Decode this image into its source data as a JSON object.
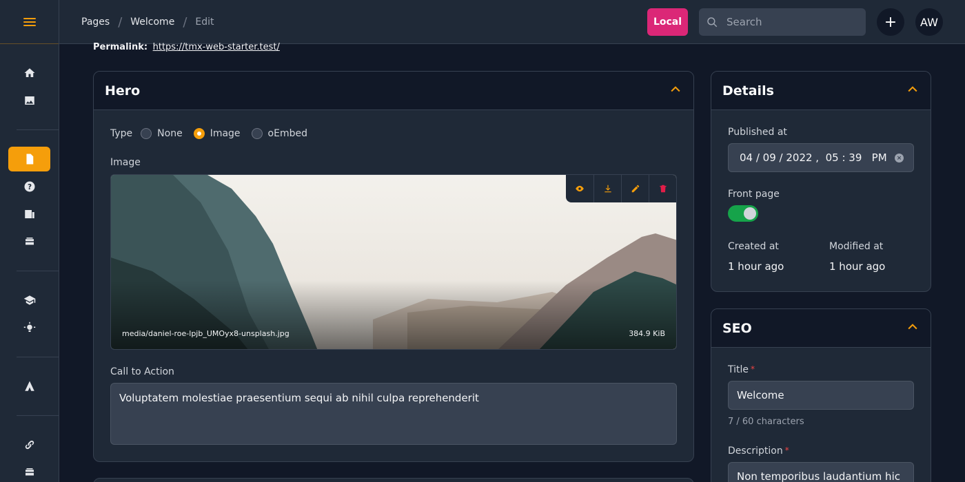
{
  "sidebar": {
    "menu_icon": "hamburger-icon",
    "items": [
      {
        "name": "home-icon"
      },
      {
        "name": "image-icon"
      },
      {
        "name": "page-icon",
        "active": true
      },
      {
        "name": "help-icon"
      },
      {
        "name": "article-icon"
      },
      {
        "name": "stack-icon"
      },
      {
        "name": "education-icon"
      },
      {
        "name": "bulb-icon"
      },
      {
        "name": "triangle-logo-icon"
      },
      {
        "name": "link-icon"
      },
      {
        "name": "stack-icon-2"
      }
    ]
  },
  "header": {
    "breadcrumbs": [
      "Pages",
      "Welcome",
      "Edit"
    ],
    "env_badge": "Local",
    "search_placeholder": "Search",
    "add_label": "+",
    "avatar_initials": "AW"
  },
  "permalink": {
    "label": "Permalink:",
    "url": "https://tmx-web-starter.test/"
  },
  "hero": {
    "title": "Hero",
    "type_label": "Type",
    "type_options": [
      "None",
      "Image",
      "oEmbed"
    ],
    "type_selected": "Image",
    "image_label": "Image",
    "image_filename": "media/daniel-roe-lpjb_UMOyx8-unsplash.jpg",
    "image_size": "384.9 KiB",
    "cta_label": "Call to Action",
    "cta_value": "Voluptatem molestiae praesentium sequi ab nihil culpa reprehenderit"
  },
  "details": {
    "title": "Details",
    "published_label": "Published at",
    "published_value": "04 / 09 / 2022 ,  05 : 39   PM",
    "front_page_label": "Front page",
    "front_page_on": true,
    "created_label": "Created at",
    "created_value": "1 hour ago",
    "modified_label": "Modified at",
    "modified_value": "1 hour ago"
  },
  "seo": {
    "title": "SEO",
    "title_label": "Title",
    "title_value": "Welcome",
    "title_counter": "7 / 60 characters",
    "description_label": "Description",
    "description_value": "Non temporibus laudantium hic"
  },
  "colors": {
    "accent": "#f59e0b",
    "badge": "#db2777",
    "toggle_on": "#16a34a"
  }
}
